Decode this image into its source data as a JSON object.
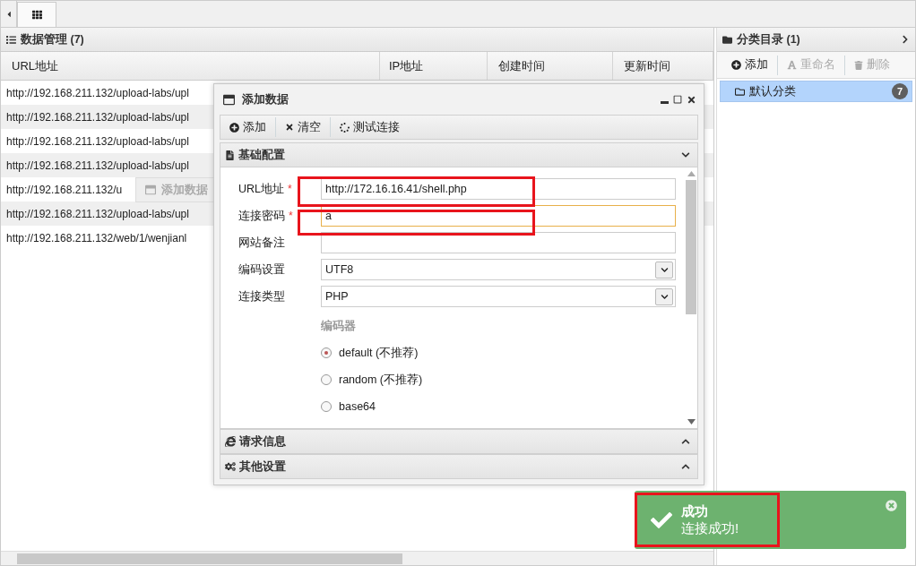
{
  "tab_bar": {
    "tabs": [
      {
        "selected": true
      }
    ]
  },
  "data_panel": {
    "title": "数据管理 (7)",
    "columns": [
      "URL地址",
      "IP地址",
      "创建时间",
      "更新时间"
    ],
    "rows": [
      {
        "url": "http://192.168.211.132/upload-labs/upl"
      },
      {
        "url": "http://192.168.211.132/upload-labs/upl"
      },
      {
        "url": "http://192.168.211.132/upload-labs/upl"
      },
      {
        "url": "http://192.168.211.132/upload-labs/upl"
      },
      {
        "url": "http://192.168.211.132/u"
      },
      {
        "url": "http://192.168.211.132/upload-labs/upl"
      },
      {
        "url": "http://192.168.211.132/web/1/wenjianl"
      }
    ]
  },
  "category_panel": {
    "title": "分类目录 (1)",
    "toolbar": [
      {
        "kind": "add",
        "label": "添加",
        "disabled": false
      },
      {
        "kind": "rename",
        "label": "重命名",
        "disabled": true
      },
      {
        "kind": "delete",
        "label": "删除",
        "disabled": true
      }
    ],
    "items": [
      {
        "label": "默认分类",
        "count": "7",
        "selected": true
      }
    ]
  },
  "drag_ghost": {
    "title": "添加数据"
  },
  "dialog": {
    "title": "添加数据",
    "toolbar": [
      {
        "kind": "add",
        "label": "添加"
      },
      {
        "kind": "clear",
        "label": "清空"
      },
      {
        "kind": "test",
        "label": "测试连接"
      }
    ],
    "basic_section": {
      "title": "基础配置",
      "expanded": true,
      "fields": [
        {
          "kind": "text",
          "label": "URL地址",
          "required_mark": "*",
          "value": "http://172.16.16.41/shell.php"
        },
        {
          "kind": "text",
          "label": "连接密码",
          "required_mark": "*",
          "value": "a",
          "focused": true
        },
        {
          "kind": "text",
          "label": "网站备注"
        },
        {
          "kind": "select",
          "label": "编码设置",
          "value": "UTF8"
        },
        {
          "kind": "select",
          "label": "连接类型",
          "value": "PHP"
        }
      ],
      "encoder": {
        "label": "编码器",
        "options": [
          {
            "label": "default (不推荐)",
            "selected": true
          },
          {
            "label": "random (不推荐)",
            "selected": false
          },
          {
            "label": "base64",
            "selected": false
          }
        ]
      }
    },
    "other_sections": [
      {
        "kind": "request",
        "title": "请求信息",
        "expanded": false
      },
      {
        "kind": "other",
        "title": "其他设置",
        "expanded": false
      }
    ]
  },
  "toast": {
    "title": "成功",
    "message": "连接成功!"
  }
}
